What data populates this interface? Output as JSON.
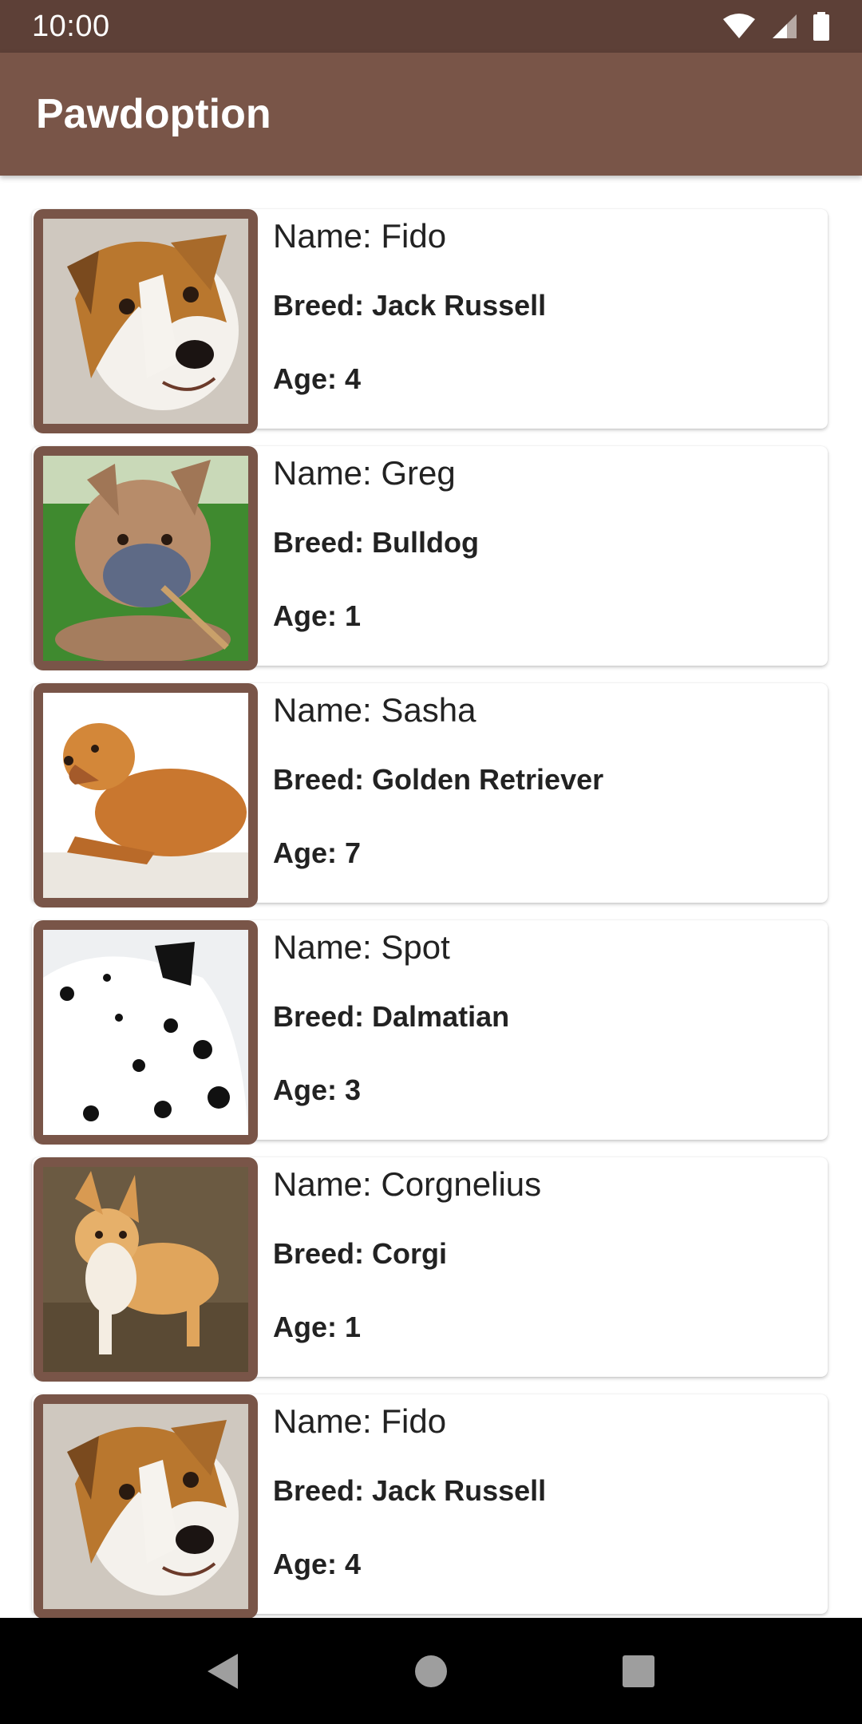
{
  "status_bar": {
    "time": "10:00",
    "icons": [
      "wifi-icon",
      "signal-icon",
      "battery-icon"
    ]
  },
  "app_bar": {
    "title": "Pawdoption"
  },
  "colors": {
    "primary": "#795548",
    "primary_dark": "#5d4037",
    "card": "#ffffff",
    "text": "#222222"
  },
  "dogs": [
    {
      "name": "Name: Fido",
      "breed": "Breed: Jack Russell",
      "age": "Age: 4",
      "photo": "jack-russell-photo"
    },
    {
      "name": "Name: Greg",
      "breed": "Breed: Bulldog",
      "age": "Age: 1",
      "photo": "bulldog-photo"
    },
    {
      "name": "Name: Sasha",
      "breed": "Breed: Golden Retriever",
      "age": "Age: 7",
      "photo": "golden-retriever-photo"
    },
    {
      "name": "Name: Spot",
      "breed": "Breed: Dalmatian",
      "age": "Age: 3",
      "photo": "dalmatian-photo"
    },
    {
      "name": "Name: Corgnelius",
      "breed": "Breed: Corgi",
      "age": "Age: 1",
      "photo": "corgi-photo"
    },
    {
      "name": "Name: Fido",
      "breed": "Breed: Jack Russell",
      "age": "Age: 4",
      "photo": "jack-russell-photo"
    }
  ],
  "nav_bar": {
    "buttons": [
      "back-icon",
      "home-icon",
      "recents-icon"
    ]
  }
}
